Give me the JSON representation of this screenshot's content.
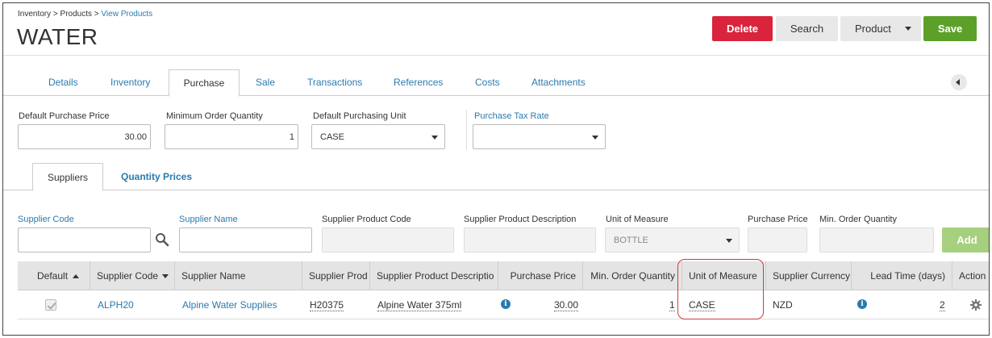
{
  "breadcrumb": {
    "part1": "Inventory",
    "sep1": ">",
    "part2": "Products",
    "sep2": ">",
    "current": "View Products"
  },
  "page_title": "WATER",
  "header_buttons": {
    "delete": "Delete",
    "search": "Search",
    "product": "Product",
    "save": "Save"
  },
  "tabs": [
    "Details",
    "Inventory",
    "Purchase",
    "Sale",
    "Transactions",
    "References",
    "Costs",
    "Attachments"
  ],
  "active_tab": "Purchase",
  "purchase_form": {
    "default_price_label": "Default Purchase Price",
    "default_price_value": "30.00",
    "min_qty_label": "Minimum Order Quantity",
    "min_qty_value": "1",
    "unit_label": "Default Purchasing Unit",
    "unit_value": "CASE",
    "tax_label": "Purchase Tax Rate",
    "tax_value": ""
  },
  "subtabs": {
    "suppliers": "Suppliers",
    "quantity_prices": "Quantity Prices"
  },
  "filters": {
    "supplier_code": "Supplier Code",
    "supplier_name": "Supplier Name",
    "product_code": "Supplier Product Code",
    "product_description": "Supplier Product Description",
    "unit_of_measure": "Unit of Measure",
    "unit_value": "BOTTLE",
    "purchase_price": "Purchase Price",
    "min_order_qty": "Min. Order Quantity",
    "add": "Add"
  },
  "table": {
    "headers": {
      "default": "Default",
      "supplier_code": "Supplier Code",
      "supplier_name": "Supplier Name",
      "product_code": "Supplier Prod",
      "product_description": "Supplier Product Descriptio",
      "purchase_price": "Purchase Price",
      "min_order_qty": "Min. Order Quantity",
      "unit_of_measure": "Unit of Measure",
      "currency": "Supplier Currency",
      "lead_time": "Lead Time (days)",
      "action": "Action"
    },
    "row": {
      "default_checked": true,
      "supplier_code": "ALPH20",
      "supplier_name": "Alpine Water Supplies",
      "product_code": "H20375",
      "product_description": "Alpine Water 375ml",
      "purchase_price": "30.00",
      "min_order_qty": "1",
      "unit_of_measure": "CASE",
      "currency": "NZD",
      "lead_time": "2"
    }
  },
  "icons": [
    "search-icon",
    "info-icon",
    "gear-icon",
    "chevron-left-icon",
    "chevron-down-icon"
  ],
  "colors": {
    "delete": "#d9243c",
    "save": "#5ca02a",
    "add": "#a6d07e",
    "link": "#2a7ab0",
    "highlight": "#d23b3b"
  }
}
